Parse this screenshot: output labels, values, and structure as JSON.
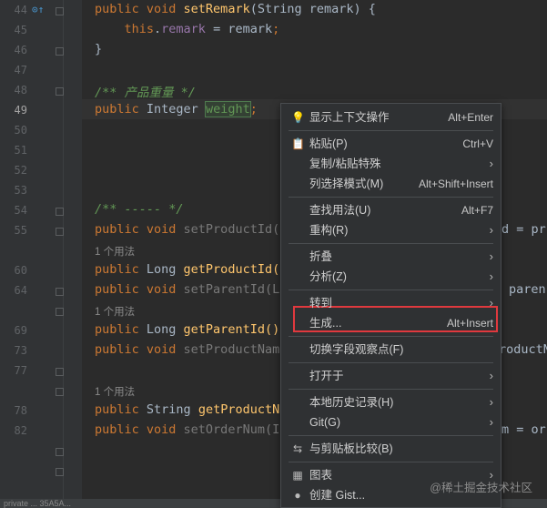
{
  "editor": {
    "lines": [
      {
        "num": "44",
        "tokens": [
          {
            "t": "public void ",
            "c": "kw"
          },
          {
            "t": "setRemark",
            "c": "fn"
          },
          {
            "t": "(String remark) {",
            "c": ""
          }
        ]
      },
      {
        "num": "45",
        "tokens": [
          {
            "t": "    ",
            "c": ""
          },
          {
            "t": "this",
            "c": "kw"
          },
          {
            "t": ".",
            "c": ""
          },
          {
            "t": "remark",
            "c": "fld"
          },
          {
            "t": " = remark",
            "c": ""
          },
          {
            "t": ";",
            "c": "kw"
          }
        ]
      },
      {
        "num": "46",
        "tokens": [
          {
            "t": "}",
            "c": ""
          }
        ]
      },
      {
        "num": "47",
        "tokens": []
      },
      {
        "num": "48",
        "tokens": [
          {
            "t": "/** 产品重量 */",
            "c": "cmt"
          }
        ]
      },
      {
        "num": "49",
        "tokens": [
          {
            "t": "public ",
            "c": "kw"
          },
          {
            "t": "Integer ",
            "c": ""
          },
          {
            "t": "weight",
            "c": "hl"
          },
          {
            "t": ";",
            "c": "kw"
          }
        ]
      },
      {
        "num": "50",
        "tokens": []
      },
      {
        "num": "51",
        "tokens": []
      },
      {
        "num": "52",
        "tokens": []
      },
      {
        "num": "53",
        "tokens": []
      },
      {
        "num": "54",
        "tokens": [
          {
            "t": "/** ----- */",
            "c": "cmt"
          }
        ]
      },
      {
        "num": "55",
        "tokens": [
          {
            "t": "public void ",
            "c": "kw"
          },
          {
            "t": "setProductId(P",
            "c": "dim"
          }
        ]
      },
      {
        "num": "",
        "usage": "1 个用法"
      },
      {
        "num": "60",
        "tokens": [
          {
            "t": "public ",
            "c": "kw"
          },
          {
            "t": "Long ",
            "c": ""
          },
          {
            "t": "getProductId()",
            "c": "fn"
          }
        ]
      },
      {
        "num": "64",
        "tokens": [
          {
            "t": "public void ",
            "c": "kw"
          },
          {
            "t": "setParentId(Lo",
            "c": "dim"
          }
        ]
      },
      {
        "num": "",
        "usage": "1 个用法"
      },
      {
        "num": "69",
        "tokens": [
          {
            "t": "public ",
            "c": "kw"
          },
          {
            "t": "Long ",
            "c": ""
          },
          {
            "t": "getParentId()",
            "c": "fn"
          }
        ]
      },
      {
        "num": "73",
        "tokens": [
          {
            "t": "public void ",
            "c": "kw"
          },
          {
            "t": "setProductName",
            "c": "dim"
          }
        ]
      },
      {
        "num": "77",
        "tokens": []
      },
      {
        "num": "",
        "usage": "1 个用法"
      },
      {
        "num": "78",
        "tokens": [
          {
            "t": "public ",
            "c": "kw"
          },
          {
            "t": "String ",
            "c": ""
          },
          {
            "t": "getProductNa",
            "c": "fn"
          }
        ]
      },
      {
        "num": "82",
        "tokens": [
          {
            "t": "public void ",
            "c": "kw"
          },
          {
            "t": "setOrderNum(In",
            "c": "dim"
          }
        ]
      }
    ],
    "right_fragments": [
      {
        "text": "d = pr",
        "line": 11
      },
      {
        "text": "paren",
        "line": 14
      },
      {
        "text": "roductN",
        "line": 17
      },
      {
        "text": "m = or",
        "line": 21
      }
    ],
    "bottom_text": "private ... 35A5A..."
  },
  "context_menu": {
    "items": [
      {
        "icon": "lightbulb-icon",
        "glyph": "💡",
        "label": "显示上下文操作",
        "shortcut": "Alt+Enter",
        "arrow": false
      },
      {
        "sep": true
      },
      {
        "icon": "clipboard-icon",
        "glyph": "📋",
        "label": "粘贴(P)",
        "shortcut": "Ctrl+V",
        "arrow": false
      },
      {
        "label": "复制/粘贴特殊",
        "shortcut": "",
        "arrow": true
      },
      {
        "label": "列选择模式(M)",
        "shortcut": "Alt+Shift+Insert",
        "arrow": false
      },
      {
        "sep": true
      },
      {
        "label": "查找用法(U)",
        "shortcut": "Alt+F7",
        "arrow": false
      },
      {
        "label": "重构(R)",
        "shortcut": "",
        "arrow": true
      },
      {
        "sep": true
      },
      {
        "label": "折叠",
        "shortcut": "",
        "arrow": true
      },
      {
        "label": "分析(Z)",
        "shortcut": "",
        "arrow": true
      },
      {
        "sep": true
      },
      {
        "label": "转到",
        "shortcut": "",
        "arrow": true
      },
      {
        "label": "生成...",
        "shortcut": "Alt+Insert",
        "arrow": false
      },
      {
        "sep": true
      },
      {
        "label": "切换字段观察点(F)",
        "shortcut": "",
        "arrow": false
      },
      {
        "sep": true
      },
      {
        "label": "打开于",
        "shortcut": "",
        "arrow": true
      },
      {
        "sep": true
      },
      {
        "label": "本地历史记录(H)",
        "shortcut": "",
        "arrow": true
      },
      {
        "label": "Git(G)",
        "shortcut": "",
        "arrow": true
      },
      {
        "sep": true
      },
      {
        "icon": "compare-icon",
        "glyph": "⇆",
        "label": "与剪贴板比较(B)",
        "shortcut": "",
        "arrow": false
      },
      {
        "sep": true
      },
      {
        "icon": "diagram-icon",
        "glyph": "▦",
        "label": "图表",
        "shortcut": "",
        "arrow": true
      },
      {
        "icon": "github-icon",
        "glyph": "●",
        "label": "创建 Gist...",
        "shortcut": "",
        "arrow": false
      }
    ],
    "highlight_color": "#e0393e"
  },
  "watermark": "@稀土掘金技术社区"
}
